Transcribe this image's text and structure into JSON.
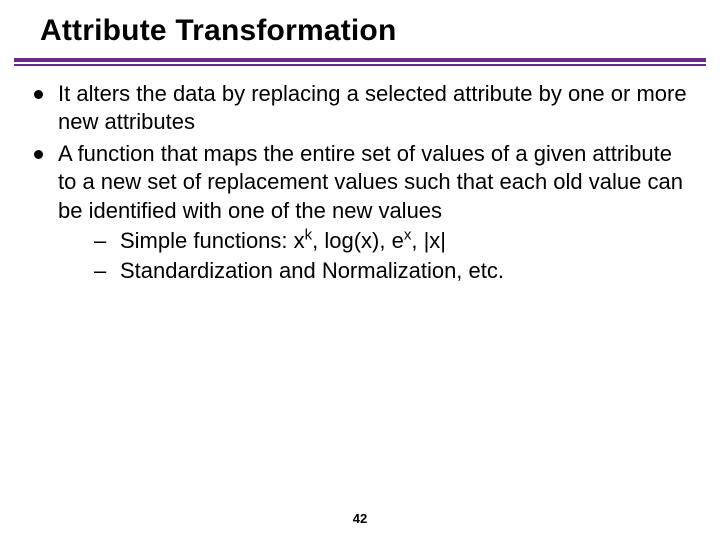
{
  "title": "Attribute Transformation",
  "bullets": [
    "It alters the data by replacing a selected attribute by one or more new attributes",
    "A function that maps the entire set of values of a given attribute to a new set of replacement values such that each old value can be identified with one of the new values"
  ],
  "sub_prefix": "Simple functions: ",
  "sub_functions": {
    "f1_base": "x",
    "f1_sup": "k",
    "sep1": ", ",
    "f2": "log(x)",
    "sep2": ", ",
    "f3_base": "e",
    "f3_sup": "x",
    "sep3": ", ",
    "f4": "|x|"
  },
  "sub2": "Standardization and Normalization, etc.",
  "page": "42"
}
